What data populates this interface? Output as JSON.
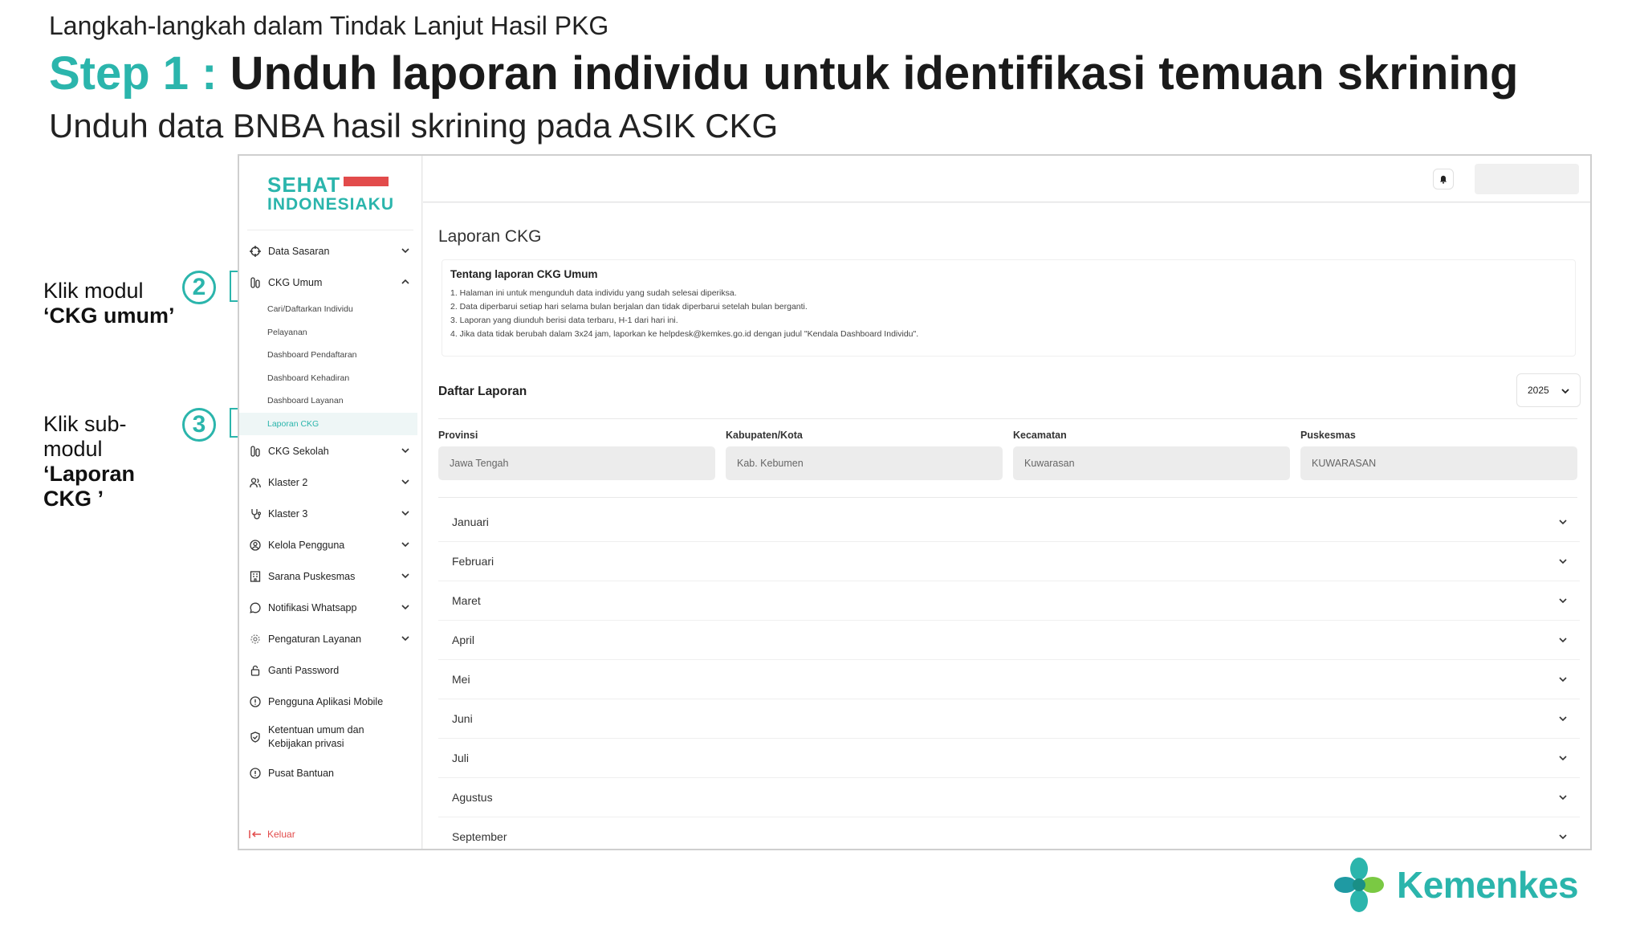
{
  "slide": {
    "kicker": "Langkah-langkah dalam Tindak Lanjut Hasil PKG",
    "step_label": "Step 1 :",
    "title": "Unduh laporan individu untuk identifikasi temuan skrining",
    "subtitle": "Unduh data BNBA hasil skrining pada ASIK CKG"
  },
  "annotations": {
    "a2": {
      "number": "2",
      "text_1": "Klik modul",
      "text_2": "‘CKG umum’"
    },
    "a3": {
      "number": "3",
      "text_1": "Klik sub-",
      "text_2": "modul",
      "text_3": "‘Laporan",
      "text_4": "CKG ’"
    }
  },
  "brand": {
    "logo_line1": "SEHAT",
    "logo_line2": "INDONESIAKU",
    "footer_logo": "Kemenkes",
    "accent_color": "#2bb5ac",
    "red_color": "#e24b4b"
  },
  "sidebar": {
    "items": [
      {
        "label": "Data Sasaran",
        "icon": "crosshair-icon"
      },
      {
        "label": "CKG Umum",
        "icon": "test-tubes-icon"
      },
      {
        "label": "CKG Sekolah",
        "icon": "test-tubes-icon"
      },
      {
        "label": "Klaster 2",
        "icon": "users-icon"
      },
      {
        "label": "Klaster 3",
        "icon": "stethoscope-icon"
      },
      {
        "label": "Kelola Pengguna",
        "icon": "user-circle-icon"
      },
      {
        "label": "Sarana Puskesmas",
        "icon": "building-icon"
      },
      {
        "label": "Notifikasi Whatsapp",
        "icon": "chat-bubble-icon"
      },
      {
        "label": "Pengaturan Layanan",
        "icon": "gear-icon"
      },
      {
        "label": "Ganti Password",
        "icon": "lock-icon"
      },
      {
        "label": "Pengguna Aplikasi Mobile",
        "icon": "info-icon"
      },
      {
        "label": "Ketentuan umum dan Kebijakan privasi",
        "label_1": "Ketentuan umum dan",
        "label_2": "Kebijakan privasi",
        "icon": "shield-check-icon"
      },
      {
        "label": "Pusat Bantuan",
        "icon": "info-icon"
      }
    ],
    "sub_items": [
      "Cari/Daftarkan Individu",
      "Pelayanan",
      "Dashboard Pendaftaran",
      "Dashboard Kehadiran",
      "Dashboard Layanan",
      "Laporan CKG"
    ],
    "logout": "Keluar"
  },
  "main": {
    "title": "Laporan CKG",
    "about": {
      "title": "Tentang laporan CKG Umum",
      "items": [
        "1. Halaman ini untuk mengunduh data individu yang sudah selesai diperiksa.",
        "2. Data diperbarui setiap hari selama bulan berjalan dan tidak diperbarui setelah bulan berganti.",
        "3. Laporan yang diunduh berisi data terbaru, H-1 dari hari ini.",
        "4. Jika data tidak berubah dalam 3x24 jam, laporkan ke helpdesk@kemkes.go.id dengan judul \"Kendala Dashboard Individu\"."
      ]
    },
    "list_title": "Daftar Laporan",
    "year": "2025",
    "filters": [
      {
        "label": "Provinsi",
        "value": "Jawa Tengah"
      },
      {
        "label": "Kabupaten/Kota",
        "value": "Kab. Kebumen"
      },
      {
        "label": "Kecamatan",
        "value": "Kuwarasan"
      },
      {
        "label": "Puskesmas",
        "value": "KUWARASAN"
      }
    ],
    "months": [
      "Januari",
      "Februari",
      "Maret",
      "April",
      "Mei",
      "Juni",
      "Juli",
      "Agustus",
      "September"
    ]
  }
}
